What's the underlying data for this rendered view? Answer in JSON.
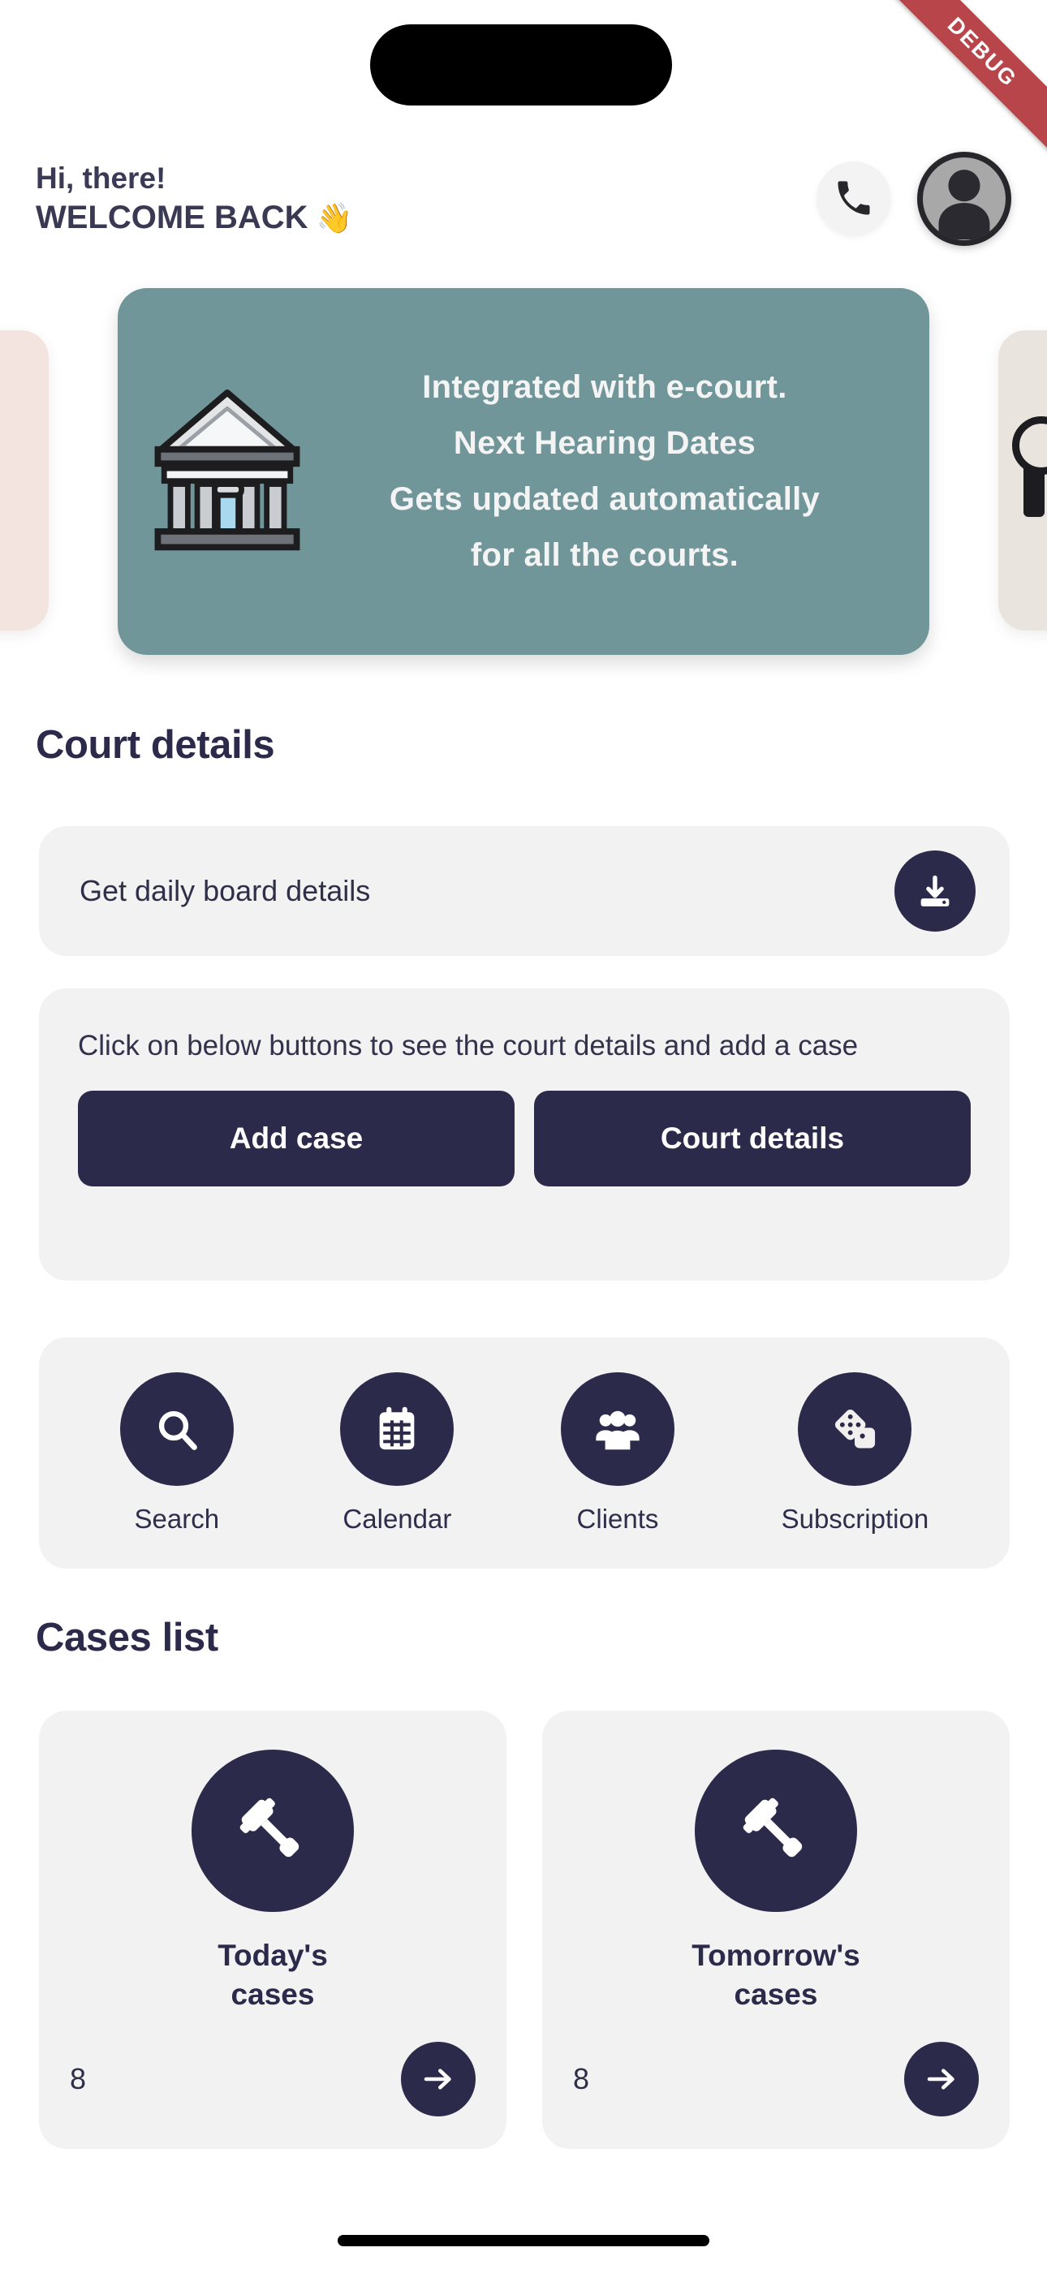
{
  "colors": {
    "navy": "#2c2a4a",
    "teal": "#719699",
    "card_bg": "#f2f2f2",
    "debug_red": "#b8454a",
    "peek_left": "#f3e4df",
    "peek_right": "#e9e4dd"
  },
  "debug_ribbon": {
    "label": "DEBUG"
  },
  "header": {
    "greeting_small": "Hi, there!",
    "greeting_large": "WELCOME BACK",
    "wave_emoji": "👋",
    "call_icon": "phone-icon",
    "avatar_icon": "user-avatar-icon"
  },
  "banner": {
    "icon": "courthouse-icon",
    "lines": [
      "Integrated with e-court.",
      "Next Hearing Dates",
      "Gets updated automatically",
      "for all the courts."
    ]
  },
  "court_details": {
    "section_title": "Court details",
    "daily_board": {
      "label": "Get daily board details",
      "action_icon": "download-icon"
    },
    "buttons_card": {
      "hint": "Click on below buttons to see the court details and add a case",
      "buttons": [
        {
          "label": "Add case",
          "name": "add-case-button"
        },
        {
          "label": "Court details",
          "name": "court-details-button"
        }
      ]
    },
    "quick_actions": [
      {
        "label": "Search",
        "icon": "search-icon"
      },
      {
        "label": "Calendar",
        "icon": "calendar-icon"
      },
      {
        "label": "Clients",
        "icon": "clients-icon"
      },
      {
        "label": "Subscription",
        "icon": "dice-icon"
      }
    ]
  },
  "cases_list": {
    "section_title": "Cases list",
    "cards": [
      {
        "title": "Today's\ncases",
        "title_line1": "Today's",
        "title_line2": "cases",
        "count": "8",
        "icon": "gavel-icon",
        "arrow_icon": "arrow-right-icon"
      },
      {
        "title": "Tomorrow's\ncases",
        "title_line1": "Tomorrow's",
        "title_line2": "cases",
        "count": "8",
        "icon": "gavel-icon",
        "arrow_icon": "arrow-right-icon"
      }
    ]
  }
}
